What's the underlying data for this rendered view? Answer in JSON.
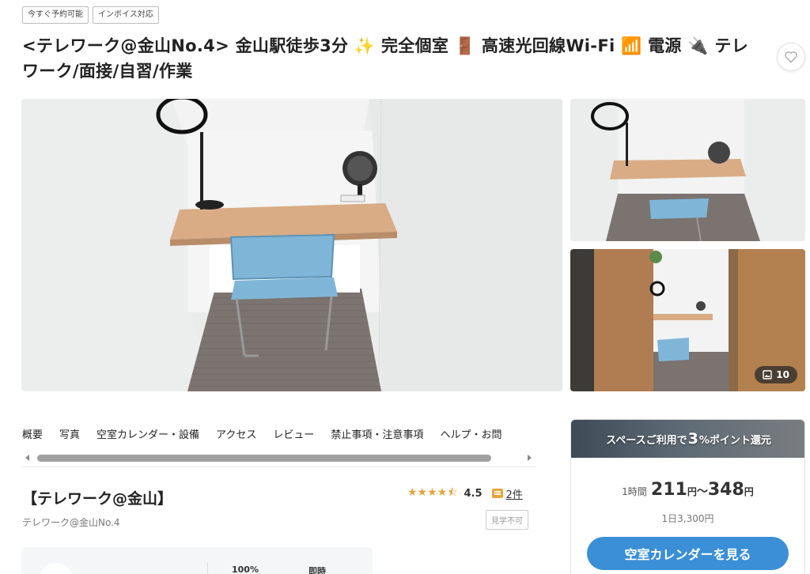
{
  "tags": [
    "今すぐ予約可能",
    "インボイス対応"
  ],
  "title": "<テレワーク@金山No.4> 金山駅徒歩3分 ✨ 完全個室 🚪 高速光回線Wi-Fi 📶 電源 🔌 テレワーク/面接/自習/作業",
  "favorite_icon": "heart-outline-icon",
  "gallery": {
    "photo_count": "10",
    "photo_count_icon": "image-icon"
  },
  "nav": {
    "tabs": [
      "概要",
      "写真",
      "空室カレンダー・設備",
      "アクセス",
      "レビュー",
      "禁止事項・注意事項",
      "ヘルプ・お問"
    ]
  },
  "space": {
    "name": "【テレワーク@金山】",
    "subtitle": "テレワーク@金山No.4",
    "rating_stars": "★★★★⯪",
    "rating": "4.5",
    "review_count": "2件",
    "visit_badge": "見学不可"
  },
  "stats": {
    "stat1": "100%",
    "stat2": "即時"
  },
  "booking": {
    "banner_pre": "スペースご利用で",
    "banner_big": "3",
    "banner_post": "%ポイント還元",
    "price_unit": "1時間",
    "price_min": "211",
    "price_yen1": "円",
    "price_sep": "〜",
    "price_max": "348",
    "price_yen2": "円",
    "day_price": "1日3,300円",
    "cta_label": "空室カレンダーを見る"
  },
  "colors": {
    "accent_blue": "#3a8fd6",
    "star_orange": "#e8a33c",
    "desk_wood": "#d9ac86",
    "chair_blue": "#7fb6d8"
  }
}
